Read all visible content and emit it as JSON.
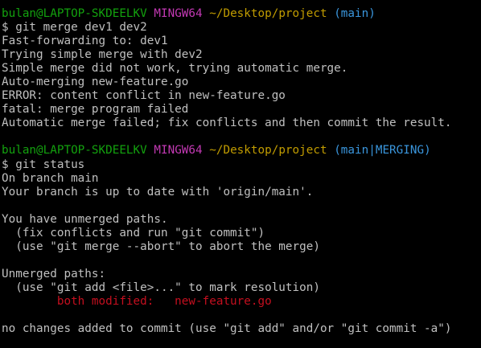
{
  "colors": {
    "background": "#000000",
    "default_text": "#c0c0c0",
    "user_host": "#13a10e",
    "system": "#c239b3",
    "path": "#c19c00",
    "branch": "#3a96dd",
    "error_red": "#c50f1f"
  },
  "terminal": {
    "lines": [
      {
        "segs": [
          {
            "t": "bulan@LAPTOP-SKDEELKV",
            "c": "user_host"
          },
          {
            "t": " ",
            "c": "default_text"
          },
          {
            "t": "MINGW64",
            "c": "system"
          },
          {
            "t": " ",
            "c": "default_text"
          },
          {
            "t": "~/Desktop/project",
            "c": "path"
          },
          {
            "t": " ",
            "c": "default_text"
          },
          {
            "t": "(main)",
            "c": "branch"
          }
        ]
      },
      {
        "segs": [
          {
            "t": "$ git merge dev1 dev2",
            "c": "default_text"
          }
        ]
      },
      {
        "segs": [
          {
            "t": "Fast-forwarding to: dev1",
            "c": "default_text"
          }
        ]
      },
      {
        "segs": [
          {
            "t": "Trying simple merge with dev2",
            "c": "default_text"
          }
        ]
      },
      {
        "segs": [
          {
            "t": "Simple merge did not work, trying automatic merge.",
            "c": "default_text"
          }
        ]
      },
      {
        "segs": [
          {
            "t": "Auto-merging new-feature.go",
            "c": "default_text"
          }
        ]
      },
      {
        "segs": [
          {
            "t": "ERROR: content conflict in new-feature.go",
            "c": "default_text"
          }
        ]
      },
      {
        "segs": [
          {
            "t": "fatal: merge program failed",
            "c": "default_text"
          }
        ]
      },
      {
        "segs": [
          {
            "t": "Automatic merge failed; fix conflicts and then commit the result.",
            "c": "default_text"
          }
        ]
      },
      {
        "segs": [
          {
            "t": "",
            "c": "default_text"
          }
        ]
      },
      {
        "segs": [
          {
            "t": "bulan@LAPTOP-SKDEELKV",
            "c": "user_host"
          },
          {
            "t": " ",
            "c": "default_text"
          },
          {
            "t": "MINGW64",
            "c": "system"
          },
          {
            "t": " ",
            "c": "default_text"
          },
          {
            "t": "~/Desktop/project",
            "c": "path"
          },
          {
            "t": " ",
            "c": "default_text"
          },
          {
            "t": "(main|MERGING)",
            "c": "branch"
          }
        ]
      },
      {
        "segs": [
          {
            "t": "$ git status",
            "c": "default_text"
          }
        ]
      },
      {
        "segs": [
          {
            "t": "On branch main",
            "c": "default_text"
          }
        ]
      },
      {
        "segs": [
          {
            "t": "Your branch is up to date with 'origin/main'.",
            "c": "default_text"
          }
        ]
      },
      {
        "segs": [
          {
            "t": "",
            "c": "default_text"
          }
        ]
      },
      {
        "segs": [
          {
            "t": "You have unmerged paths.",
            "c": "default_text"
          }
        ]
      },
      {
        "segs": [
          {
            "t": "  (fix conflicts and run \"git commit\")",
            "c": "default_text"
          }
        ]
      },
      {
        "segs": [
          {
            "t": "  (use \"git merge --abort\" to abort the merge)",
            "c": "default_text"
          }
        ]
      },
      {
        "segs": [
          {
            "t": "",
            "c": "default_text"
          }
        ]
      },
      {
        "segs": [
          {
            "t": "Unmerged paths:",
            "c": "default_text"
          }
        ]
      },
      {
        "segs": [
          {
            "t": "  (use \"git add <file>...\" to mark resolution)",
            "c": "default_text"
          }
        ]
      },
      {
        "segs": [
          {
            "t": "\t",
            "c": "default_text"
          },
          {
            "t": "both modified:   new-feature.go",
            "c": "error_red"
          }
        ]
      },
      {
        "segs": [
          {
            "t": "",
            "c": "default_text"
          }
        ]
      },
      {
        "segs": [
          {
            "t": "no changes added to commit (use \"git add\" and/or \"git commit -a\")",
            "c": "default_text"
          }
        ]
      }
    ]
  }
}
